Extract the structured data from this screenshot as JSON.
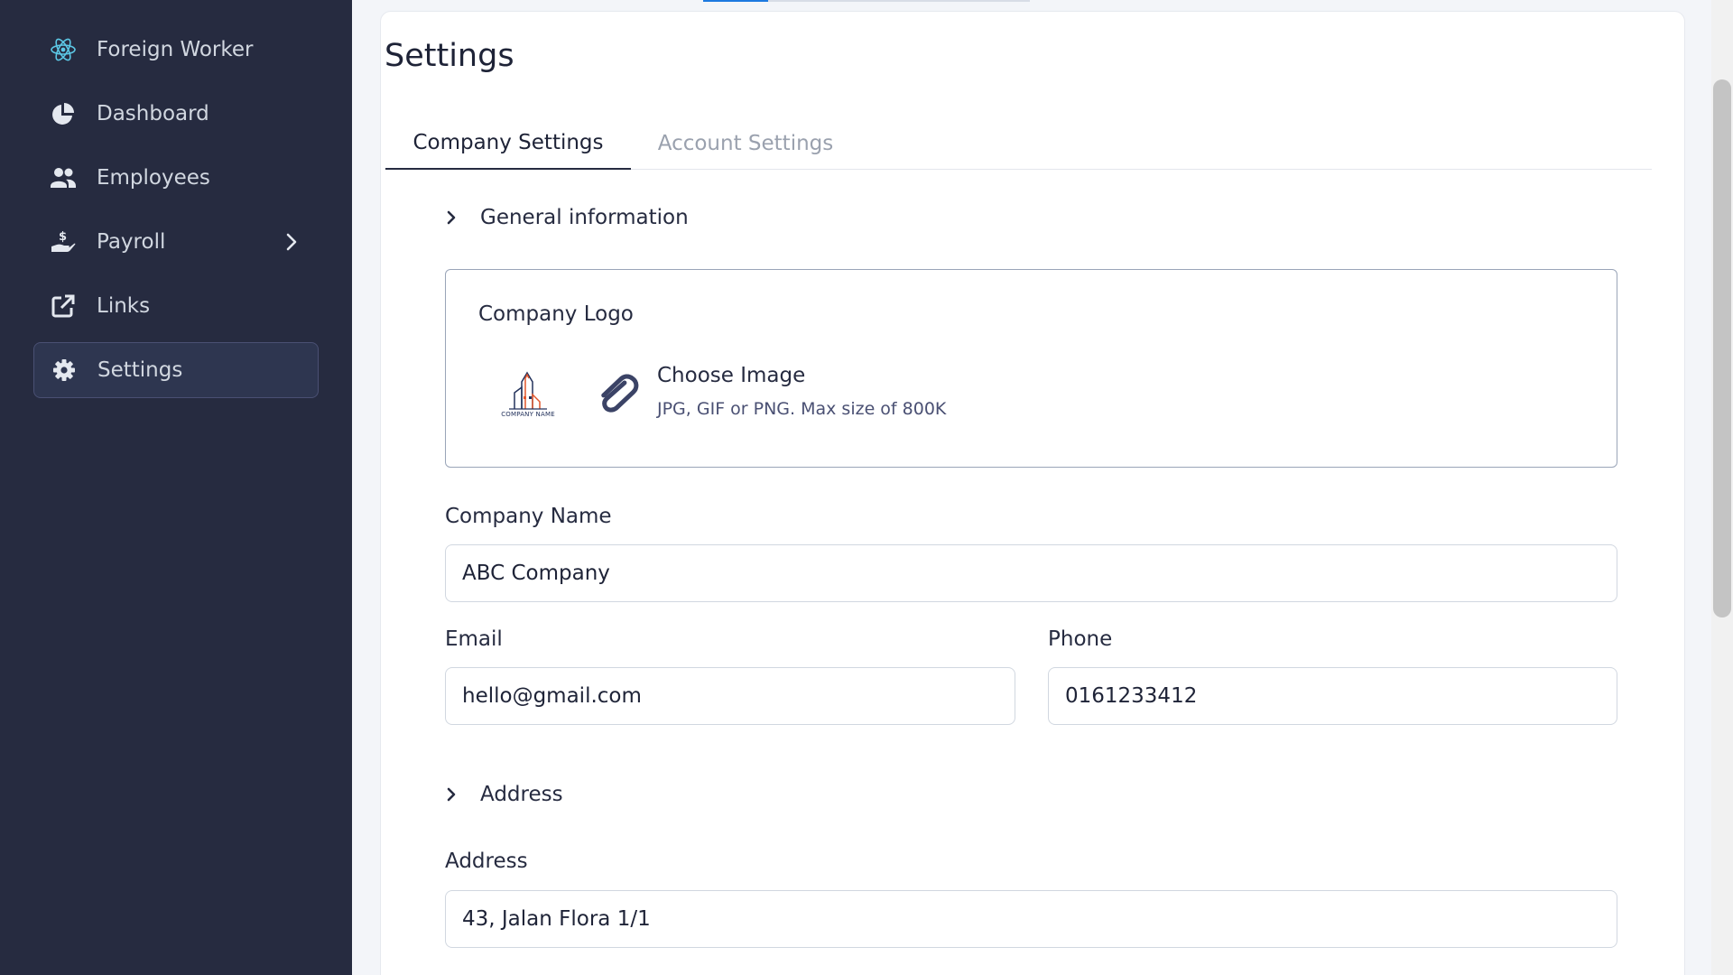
{
  "sidebar": {
    "brand": {
      "label": "Foreign Worker",
      "icon": "react-atom-icon"
    },
    "items": [
      {
        "label": "Dashboard",
        "icon": "pie-chart-icon"
      },
      {
        "label": "Employees",
        "icon": "users-icon"
      },
      {
        "label": "Payroll",
        "icon": "hand-dollar-icon",
        "has_submenu": true
      },
      {
        "label": "Links",
        "icon": "external-link-icon"
      },
      {
        "label": "Settings",
        "icon": "gear-icon",
        "active": true
      }
    ]
  },
  "page": {
    "title": "Settings",
    "tabs": [
      {
        "label": "Company Settings",
        "active": true
      },
      {
        "label": "Account Settings",
        "active": false
      }
    ]
  },
  "general": {
    "section_label": "General information",
    "logo": {
      "label": "Company Logo",
      "thumb_caption": "COMPANY NAME",
      "choose_label": "Choose Image",
      "hint": "JPG, GIF or PNG. Max size of 800K"
    },
    "company_name": {
      "label": "Company Name",
      "value": "ABC Company"
    },
    "email": {
      "label": "Email",
      "value": "hello@gmail.com"
    },
    "phone": {
      "label": "Phone",
      "value": "0161233412"
    }
  },
  "address": {
    "section_label": "Address",
    "address_field": {
      "label": "Address",
      "value": "43, Jalan Flora 1/1"
    }
  },
  "colors": {
    "sidebar_bg": "#262b40",
    "accent": "#1d7ae0",
    "text_dark": "#1e2337"
  }
}
